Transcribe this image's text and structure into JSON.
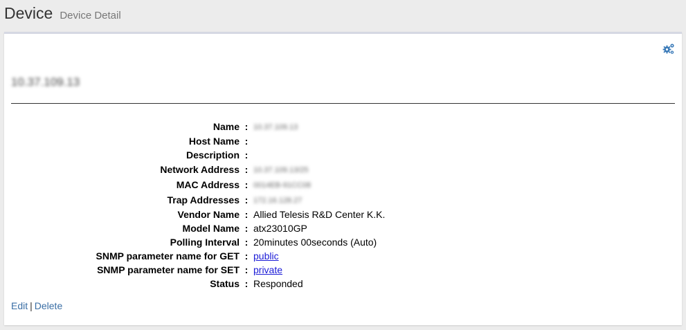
{
  "header": {
    "title": "Device",
    "subtitle": "Device Detail"
  },
  "panel": {
    "settings_icon": "gears-icon",
    "device_heading": "10.37.109.13",
    "details": [
      {
        "label": "Name",
        "value": "10.37.109.13",
        "type": "blurred"
      },
      {
        "label": "Host Name",
        "value": "",
        "type": "text"
      },
      {
        "label": "Description",
        "value": "",
        "type": "text"
      },
      {
        "label": "Network Address",
        "value": "10.37.109.13/25",
        "type": "blurred"
      },
      {
        "label": "MAC Address",
        "value": "0014EB-91CC08",
        "type": "blurred"
      },
      {
        "label": "Trap Addresses",
        "value": "172.16.128.27",
        "type": "blurred"
      },
      {
        "label": "Vendor Name",
        "value": "Allied Telesis R&D Center K.K.",
        "type": "text"
      },
      {
        "label": "Model Name",
        "value": "atx23010GP",
        "type": "text"
      },
      {
        "label": "Polling Interval",
        "value": "20minutes 00seconds (Auto)",
        "type": "text"
      },
      {
        "label": "SNMP parameter name for GET",
        "value": "public",
        "type": "link"
      },
      {
        "label": "SNMP parameter name for SET",
        "value": "private",
        "type": "link"
      },
      {
        "label": "Status",
        "value": "Responded",
        "type": "text"
      }
    ],
    "separator": ":",
    "actions": {
      "edit": "Edit",
      "divider": "|",
      "delete": "Delete"
    }
  },
  "colors": {
    "link": "#1a1ad6",
    "action_link": "#3a6ea5",
    "icon": "#3a7ab8",
    "background": "#ececec",
    "panel_border": "#d5d8e3"
  }
}
